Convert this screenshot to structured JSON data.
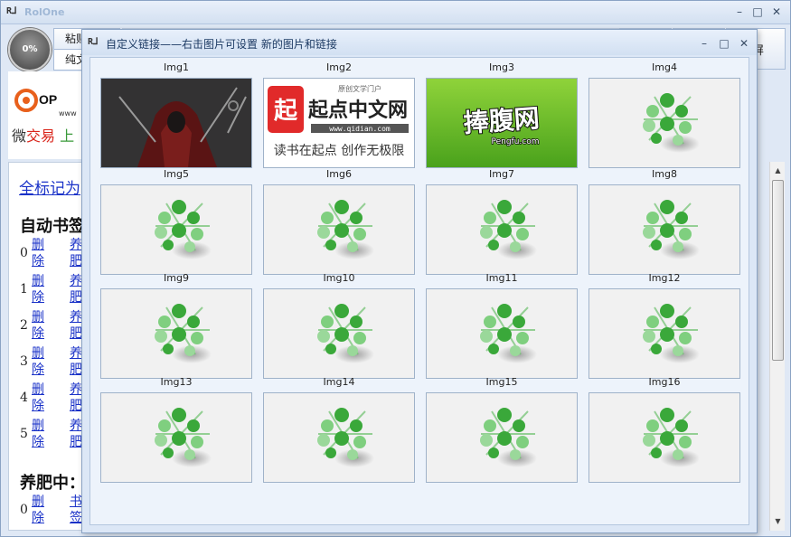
{
  "app": {
    "title": "RolOne",
    "logo": "R⅃"
  },
  "progress": {
    "text": "0%"
  },
  "tabs": {
    "paste": "粘贴",
    "plain": "纯文"
  },
  "right_button": "屏",
  "brand": {
    "text_a": "微",
    "text_b": "交易",
    "text_c": "上",
    "url_fragment": "www"
  },
  "content": {
    "top_link": "全标记为",
    "section1": "自动书签",
    "rows": [
      {
        "num": "0",
        "del": "删除",
        "tag": "养肥"
      },
      {
        "num": "1",
        "del": "删除",
        "tag": "养肥"
      },
      {
        "num": "2",
        "del": "删除",
        "tag": "养肥"
      },
      {
        "num": "3",
        "del": "删除",
        "tag": "养肥"
      },
      {
        "num": "4",
        "del": "删除",
        "tag": "养肥"
      },
      {
        "num": "5",
        "del": "删除",
        "tag": "养肥"
      }
    ],
    "section2": "养肥中：",
    "rows2": [
      {
        "num": "0",
        "del": "删除",
        "tag": "书签"
      }
    ]
  },
  "dialog": {
    "logo": "R⅃",
    "title": "自定义链接——右击图片可设置 新的图片和链接",
    "tiles": [
      {
        "label": "Img1",
        "kind": "photo"
      },
      {
        "label": "Img2",
        "kind": "qidian",
        "name": "起点中文网",
        "domain": "www.qidian.com",
        "tagline": "读书在起点 创作无极限",
        "small": "原创文学门户"
      },
      {
        "label": "Img3",
        "kind": "pengfu",
        "name": "捧腹网",
        "domain": "Pengfu.com"
      },
      {
        "label": "Img4",
        "kind": "placeholder"
      },
      {
        "label": "Img5",
        "kind": "placeholder"
      },
      {
        "label": "Img6",
        "kind": "placeholder"
      },
      {
        "label": "Img7",
        "kind": "placeholder"
      },
      {
        "label": "Img8",
        "kind": "placeholder"
      },
      {
        "label": "Img9",
        "kind": "placeholder"
      },
      {
        "label": "Img10",
        "kind": "placeholder"
      },
      {
        "label": "Img11",
        "kind": "placeholder"
      },
      {
        "label": "Img12",
        "kind": "placeholder"
      },
      {
        "label": "Img13",
        "kind": "placeholder"
      },
      {
        "label": "Img14",
        "kind": "placeholder"
      },
      {
        "label": "Img15",
        "kind": "placeholder"
      },
      {
        "label": "Img16",
        "kind": "placeholder"
      }
    ]
  },
  "colors": {
    "accent": "#1a32c8",
    "brand_red": "#d9261c",
    "leaf_green": "#3aa83a",
    "pengfu_green": "#6cbf2c"
  }
}
